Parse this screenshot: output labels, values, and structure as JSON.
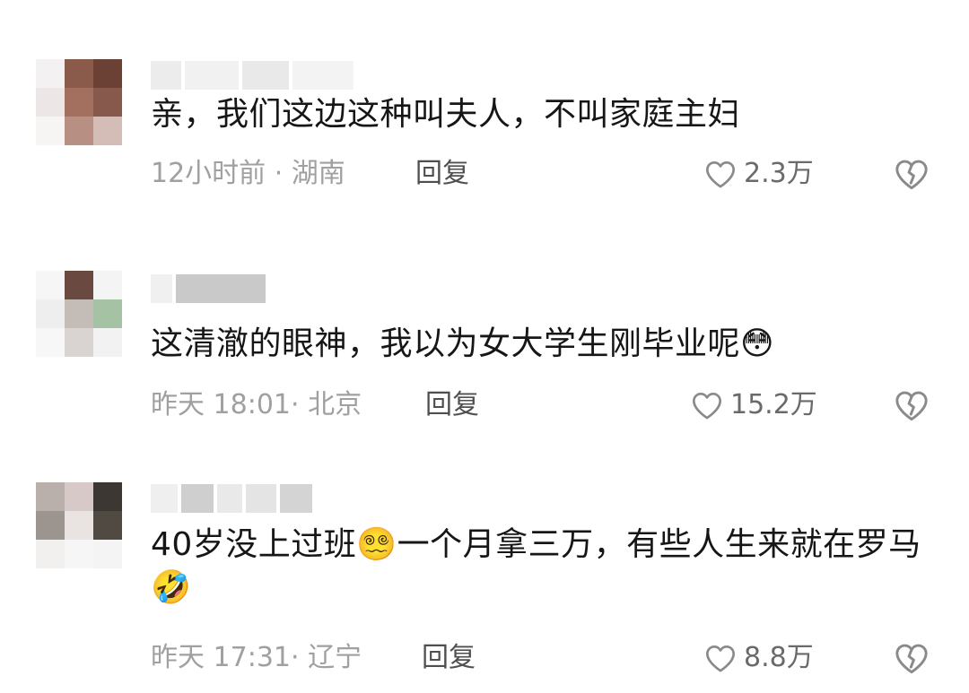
{
  "comments": [
    {
      "text_parts": [
        "亲，我们这边这种叫夫人，不叫家庭主妇"
      ],
      "time": "12小时前",
      "location": "湖南",
      "meta_separator": " · ",
      "reply_label": "回复",
      "likes": "2.3万",
      "emojis": []
    },
    {
      "text_parts": [
        "这清澈的眼神，我以为女大学生刚毕业呢"
      ],
      "time": "昨天 18:01",
      "location": "北京",
      "meta_separator": "· ",
      "reply_label": "回复",
      "likes": "15.2万",
      "emojis": [
        "😳"
      ]
    },
    {
      "text_parts": [
        "40岁没上过班",
        "一个月拿三万，有些人生来就在罗马"
      ],
      "time": "昨天 17:31",
      "location": "辽宁",
      "meta_separator": "· ",
      "reply_label": "回复",
      "likes": "8.8万",
      "emojis": [
        "😵‍💫",
        "🤣"
      ]
    }
  ],
  "colors": {
    "text_primary": "#161616",
    "text_meta": "#a0a0a0",
    "reply": "#4f4f4f",
    "icon": "#8a8a8a"
  },
  "icons": {
    "like": "heart-outline-icon",
    "dislike": "broken-heart-icon"
  }
}
